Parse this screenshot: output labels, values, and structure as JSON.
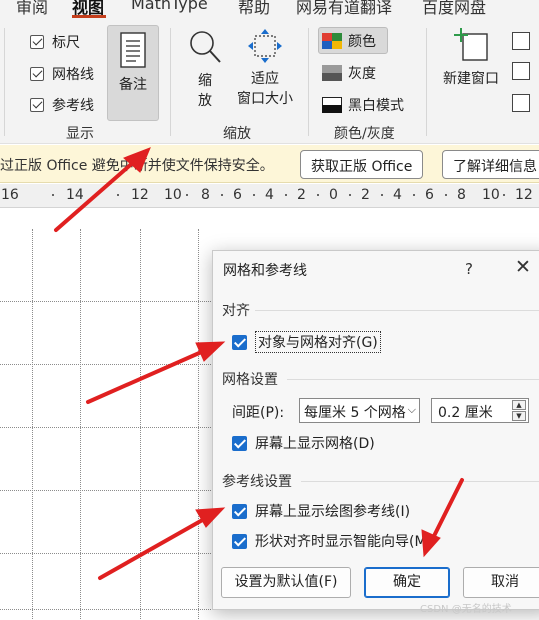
{
  "ribbon": {
    "tabs": [
      {
        "label": "审阅"
      },
      {
        "label": "视图"
      },
      {
        "label": "MathType"
      },
      {
        "label": "帮助"
      },
      {
        "label": "网易有道翻译"
      },
      {
        "label": "百度网盘"
      }
    ],
    "active_tab": "视图",
    "show_group": {
      "label": "显示",
      "checkboxes": [
        {
          "label": "标尺",
          "checked": true
        },
        {
          "label": "网格线",
          "checked": true
        },
        {
          "label": "参考线",
          "checked": true
        }
      ],
      "notes_button": "备注"
    },
    "zoom_group": {
      "label": "缩放",
      "zoom_button": "缩\n放",
      "zoom_button_line1": "缩",
      "zoom_button_line2": "放",
      "fit_button_line1": "适应",
      "fit_button_line2": "窗口大小"
    },
    "color_group": {
      "label": "颜色/灰度",
      "options": [
        {
          "label": "颜色",
          "selected": true
        },
        {
          "label": "灰度",
          "selected": false
        },
        {
          "label": "黑白模式",
          "selected": false
        }
      ]
    },
    "window_group": {
      "new_window": "新建窗口"
    }
  },
  "notice": {
    "text": "过正版 Office 避免中断并使文件保持安全。",
    "get_office_button": "获取正版 Office",
    "learn_more_button": "了解详细信息"
  },
  "ruler": {
    "numbers": [
      "16",
      "14",
      "12",
      "10",
      "8",
      "6",
      "4",
      "2",
      "0",
      "2",
      "4",
      "6",
      "8",
      "10",
      "12"
    ]
  },
  "dialog": {
    "title": "网格和参考线",
    "help": "?",
    "close": "✕",
    "align_section": {
      "label": "对齐",
      "snap_to_grid": {
        "label": "对象与网格对齐(G)",
        "checked": true
      }
    },
    "grid_section": {
      "label": "网格设置",
      "spacing_label": "间距(P):",
      "spacing_select": "每厘米 5 个网格",
      "spacing_value": "0.2 厘米",
      "show_grid": {
        "label": "屏幕上显示网格(D)",
        "checked": true
      }
    },
    "guides_section": {
      "label": "参考线设置",
      "show_guides": {
        "label": "屏幕上显示绘图参考线(I)",
        "checked": true
      },
      "smart_guides": {
        "label": "形状对齐时显示智能向导(M)",
        "checked": true
      }
    },
    "buttons": {
      "set_default": "设置为默认值(F)",
      "ok": "确定",
      "cancel": "取消"
    }
  },
  "colors": {
    "accent": "#1a6dcc",
    "annotation_arrow": "#e02020",
    "notice_bg": "#fdf6d8"
  },
  "watermark": "CSDN @无名的技术"
}
